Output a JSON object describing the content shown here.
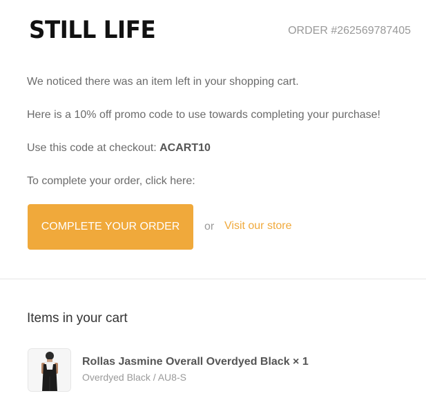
{
  "header": {
    "logo_text": "STILL LIFE",
    "order_number": "ORDER #262569787405"
  },
  "message": {
    "line1": "We noticed there was an item left in your shopping cart.",
    "line2": "Here is a 10% off promo code to use towards completing your purchase!",
    "line3_prefix": "Use this code at checkout: ",
    "promo_code": "ACART10",
    "line4": "To complete your order, click here:"
  },
  "actions": {
    "complete_order_label": "COMPLETE YOUR ORDER",
    "or_text": "or",
    "visit_store_label": "Visit our store"
  },
  "cart": {
    "section_title": "Items in your cart",
    "items": [
      {
        "title": "Rollas Jasmine Overall Overdyed Black × 1",
        "variant": "Overdyed Black / AU8-S",
        "image_icon": "overall-product-image"
      }
    ]
  },
  "colors": {
    "accent": "#f0a93b",
    "text": "#6b6b6b",
    "muted": "#999999"
  }
}
